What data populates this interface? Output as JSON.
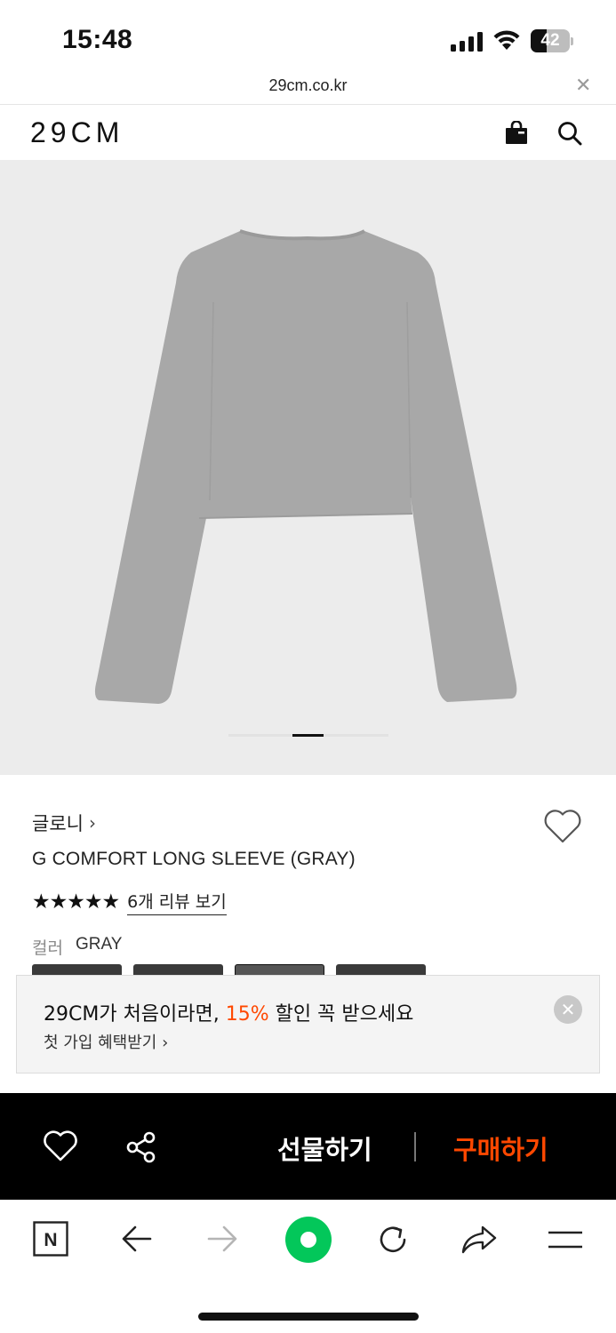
{
  "status_bar": {
    "time": "15:48",
    "battery": "42",
    "battery_level": 0.42,
    "icons": [
      "signal-icon",
      "wifi-icon",
      "battery-icon"
    ]
  },
  "browser": {
    "url": "29cm.co.kr",
    "close_icon": "close-icon"
  },
  "header": {
    "logo": "29CM",
    "icons": [
      "shopping-bag-icon",
      "search-icon"
    ]
  },
  "product": {
    "brand": "글로니",
    "brand_chevron": "›",
    "title": "G COMFORT LONG SLEEVE (GRAY)",
    "rating_stars": 5,
    "stars": "★★★★★",
    "review_link": "6개 리뷰 보기",
    "color_label": "컬러",
    "color_value": "GRAY",
    "image_alt_color": "#a8a8a8",
    "carousel_index": 1
  },
  "promo": {
    "title_before": "29CM가 처음이라면, ",
    "title_highlight": "15%",
    "title_after": " 할인 꼭 받으세요",
    "subtitle": "첫 가입 혜택받기 ›",
    "close": "✕",
    "highlight_color": "#ff4800"
  },
  "actions": {
    "gift": "선물하기",
    "buy": "구매하기",
    "buy_color": "#ff4800",
    "icons": [
      "heart-icon",
      "share-icon"
    ]
  },
  "browser_toolbar": {
    "icons": [
      "naver-icon",
      "back-arrow-icon",
      "forward-arrow-icon",
      "green-dot-icon",
      "refresh-icon",
      "share-arrow-icon",
      "menu-icon"
    ],
    "naver_label": "N"
  }
}
